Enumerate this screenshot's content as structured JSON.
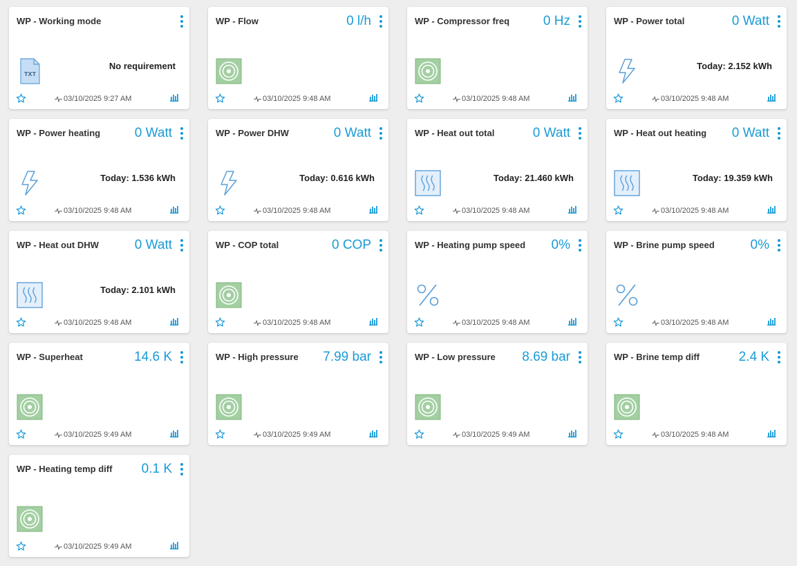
{
  "colors": {
    "accent": "#1a9bd7",
    "background": "#eeeeee",
    "card": "#ffffff",
    "sensor_icon_fill": "#a3cfa2",
    "file_icon_fill": "#c5def5"
  },
  "widgets": [
    {
      "title": "WP - Working mode",
      "value": "",
      "info": "No requirement",
      "icon": "txt-file-icon",
      "timestamp": "03/10/2025 9:27 AM"
    },
    {
      "title": "WP - Flow",
      "value": "0 l/h",
      "info": "",
      "icon": "sensor-icon",
      "timestamp": "03/10/2025 9:48 AM"
    },
    {
      "title": "WP - Compressor freq",
      "value": "0 Hz",
      "info": "",
      "icon": "sensor-icon",
      "timestamp": "03/10/2025 9:48 AM"
    },
    {
      "title": "WP - Power total",
      "value": "0 Watt",
      "info": "Today: 2.152 kWh",
      "icon": "lightning-icon",
      "timestamp": "03/10/2025 9:48 AM"
    },
    {
      "title": "WP - Power heating",
      "value": "0 Watt",
      "info": "Today: 1.536 kWh",
      "icon": "lightning-icon",
      "timestamp": "03/10/2025 9:48 AM"
    },
    {
      "title": "WP - Power DHW",
      "value": "0 Watt",
      "info": "Today: 0.616 kWh",
      "icon": "lightning-icon",
      "timestamp": "03/10/2025 9:48 AM"
    },
    {
      "title": "WP - Heat out total",
      "value": "0 Watt",
      "info": "Today: 21.460 kWh",
      "icon": "heat-icon",
      "timestamp": "03/10/2025 9:48 AM"
    },
    {
      "title": "WP - Heat out heating",
      "value": "0 Watt",
      "info": "Today: 19.359 kWh",
      "icon": "heat-icon",
      "timestamp": "03/10/2025 9:48 AM"
    },
    {
      "title": "WP - Heat out DHW",
      "value": "0 Watt",
      "info": "Today: 2.101 kWh",
      "icon": "heat-icon",
      "timestamp": "03/10/2025 9:48 AM"
    },
    {
      "title": "WP - COP total",
      "value": "0 COP",
      "info": "",
      "icon": "sensor-icon",
      "timestamp": "03/10/2025 9:48 AM"
    },
    {
      "title": "WP - Heating pump speed",
      "value": "0%",
      "info": "",
      "icon": "percent-icon",
      "timestamp": "03/10/2025 9:48 AM"
    },
    {
      "title": "WP - Brine pump speed",
      "value": "0%",
      "info": "",
      "icon": "percent-icon",
      "timestamp": "03/10/2025 9:48 AM"
    },
    {
      "title": "WP - Superheat",
      "value": "14.6 K",
      "info": "",
      "icon": "sensor-icon",
      "timestamp": "03/10/2025 9:49 AM"
    },
    {
      "title": "WP - High pressure",
      "value": "7.99 bar",
      "info": "",
      "icon": "sensor-icon",
      "timestamp": "03/10/2025 9:49 AM"
    },
    {
      "title": "WP - Low pressure",
      "value": "8.69 bar",
      "info": "",
      "icon": "sensor-icon",
      "timestamp": "03/10/2025 9:49 AM"
    },
    {
      "title": "WP - Brine temp diff",
      "value": "2.4 K",
      "info": "",
      "icon": "sensor-icon",
      "timestamp": "03/10/2025 9:48 AM"
    },
    {
      "title": "WP - Heating temp diff",
      "value": "0.1 K",
      "info": "",
      "icon": "sensor-icon",
      "timestamp": "03/10/2025 9:49 AM"
    }
  ]
}
